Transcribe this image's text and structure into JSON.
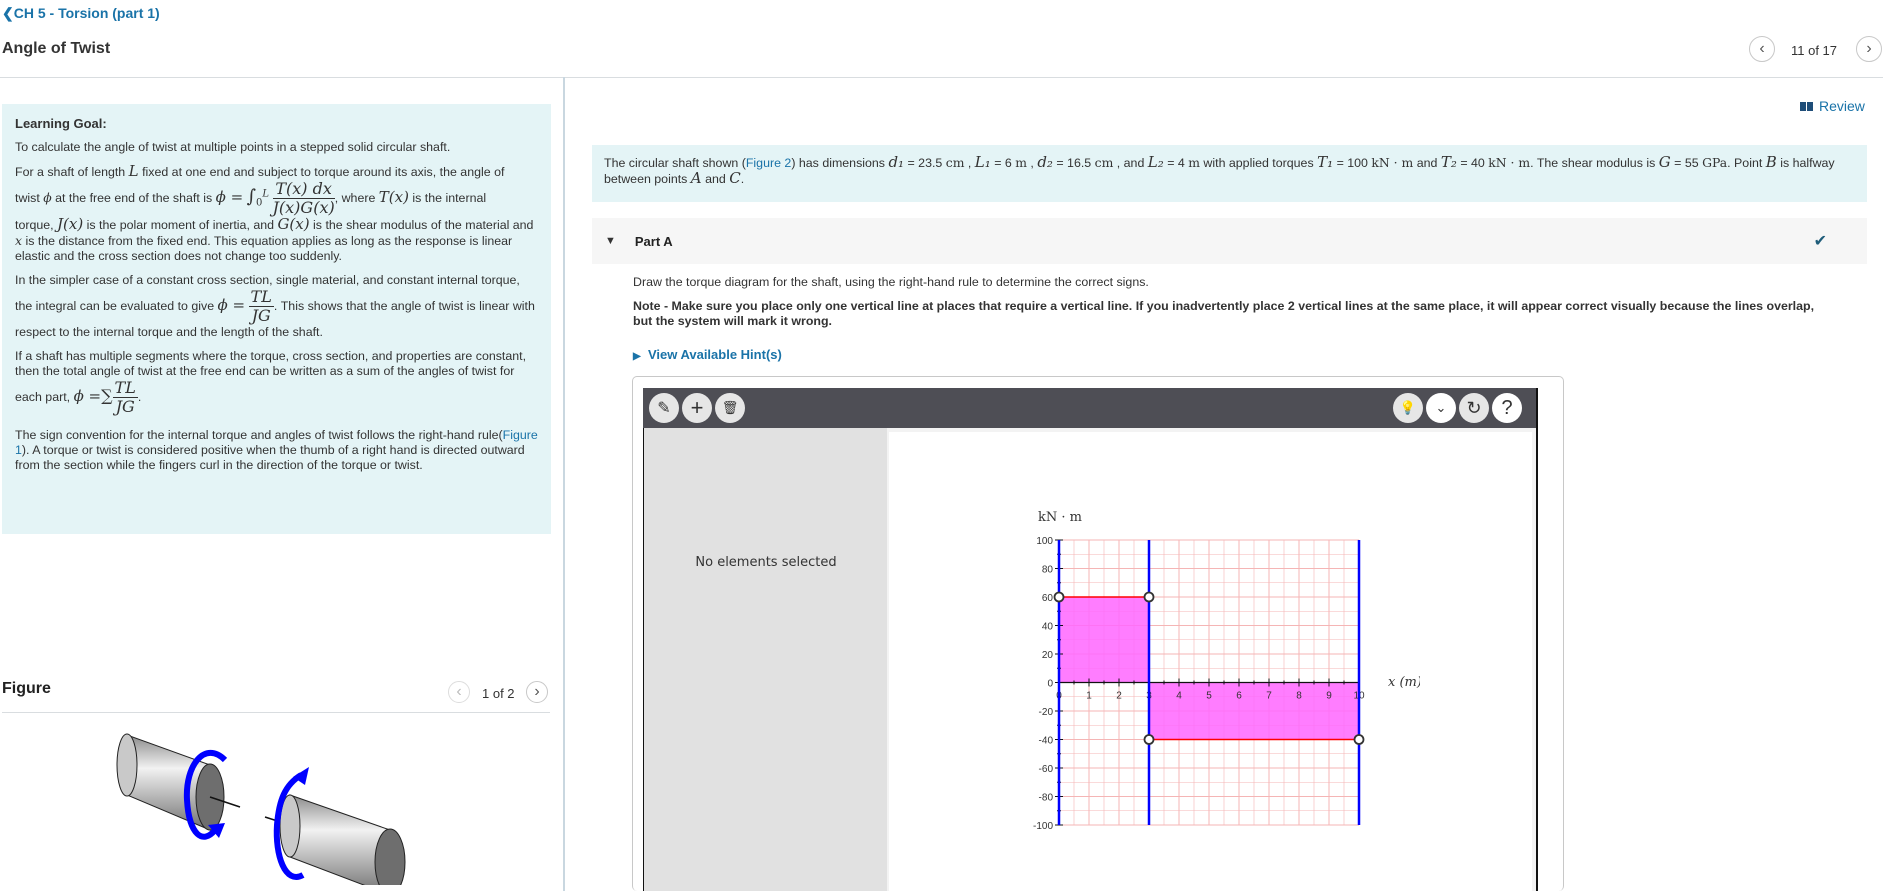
{
  "header": {
    "breadcrumb": "CH 5 - Torsion (part 1)",
    "title": "Angle of Twist",
    "pager": "11 of 17",
    "review_label": "Review"
  },
  "learning_goal": {
    "title": "Learning Goal:",
    "p1": "To calculate the angle of twist at multiple points in a stepped solid circular shaft.",
    "p2a": "For a shaft of length ",
    "p2b": " fixed at one end and subject to torque around its axis, the angle of",
    "p2c": "twist ",
    "p2d": " at the free end of the shaft is ",
    "p2e": ", where ",
    "p2f": " is the internal",
    "p2g": "torque, ",
    "p2h": " is the polar moment of inertia, and ",
    "p2i": " is the shear modulus of the material and ",
    "p2j": " is the distance from the fixed end. This equation applies as long as the response is linear elastic and the cross section does not change too suddenly.",
    "p3a": "In the simpler case of a constant cross section, single material, and constant internal torque, the integral can be evaluated to give ",
    "p3b": ". This shows that the angle of twist is linear with respect to the internal torque and the length of the shaft.",
    "p4a": "If a shaft has multiple segments where the torque, cross section, and properties are constant, then the total angle of twist at the free end can be written as a sum of the angles of twist for each part, ",
    "p5a": "The sign convention for the internal torque and angles of twist follows the right-hand rule(",
    "p5link": "Figure 1",
    "p5b": "). A torque or twist is considered positive when the thumb of a right hand is directed outward from the section while the fingers curl in the direction of the torque or twist.",
    "math": {
      "L": "L",
      "phi": "ϕ",
      "phi_eq": "ϕ =",
      "integral": "∫",
      "int_upper": "L",
      "int_lower": "0",
      "int_num": "T(x) dx",
      "int_den": "J(x)G(x)",
      "Tx": "T(x)",
      "Jx": "J(x)",
      "Gx": "G(x)",
      "x": "x",
      "tl": "TL",
      "jg": "JG",
      "sum": "∑"
    }
  },
  "figure": {
    "title": "Figure",
    "pager": "1 of 2",
    "colors": {
      "arrow": "#0000ff",
      "cylinder_end": "#6e6e6e"
    }
  },
  "problem": {
    "t1": "The circular shaft shown (",
    "link": "Figure 2",
    "t2": ") has dimensions ",
    "d1": "d₁",
    "d1v": " = 23.5 ",
    "cm": "cm",
    "L1": "L₁",
    "L1v": " = 6 ",
    "m": "m",
    "d2": "d₂",
    "d2v": " = 16.5 ",
    "L2": "L₂",
    "L2v": " = 4 ",
    "t3": " with applied torques ",
    "T1": "T₁",
    "T1v": " = 100 ",
    "knm": "kN · m",
    "t4": " and ",
    "T2": "T₂",
    "T2v": " = 40 ",
    "t5": ". The shear modulus is ",
    "G": "G",
    "Gv": " = 55 ",
    "gpa": "GPa",
    "t6": ". Point ",
    "B": "B",
    "t7": " is halfway between points ",
    "A": "A",
    "and": " and ",
    "C": "C",
    "dot": ".",
    "comma": " , ",
    "and2": " , and "
  },
  "part_a": {
    "title": "Part A",
    "instruction": "Draw the torque diagram for the shaft, using the right-hand rule to determine the correct signs.",
    "note": "Note - Make sure you place only one vertical line at places that require a vertical line. If you inadvertently place 2 vertical lines at the same place, it will appear correct visually because the lines overlap, but the system will mark it wrong.",
    "hint_label": "View Available Hint(s)",
    "status": "correct"
  },
  "tool": {
    "toolbar_left": [
      {
        "name": "draw-segment-icon",
        "glyph": "✎"
      },
      {
        "name": "add-icon",
        "glyph": "+"
      },
      {
        "name": "trash-icon",
        "glyph": "🗑"
      }
    ],
    "toolbar_right": [
      {
        "name": "lightbulb-icon",
        "glyph": "💡"
      },
      {
        "name": "chevron-down-icon",
        "glyph": "⌄"
      },
      {
        "name": "reset-icon",
        "glyph": "↻"
      },
      {
        "name": "help-icon",
        "glyph": "?"
      }
    ],
    "side_text": "No elements selected"
  },
  "chart_data": {
    "type": "area",
    "title": "",
    "ylabel": "kN · m",
    "xlabel": "x (m)",
    "xlim": [
      0,
      10
    ],
    "ylim": [
      -100,
      100
    ],
    "x_ticks": [
      0,
      1,
      2,
      3,
      4,
      5,
      6,
      7,
      8,
      9,
      10
    ],
    "y_ticks": [
      100,
      80,
      60,
      40,
      20,
      0,
      -20,
      -40,
      -60,
      -80,
      -100
    ],
    "grid": true,
    "segments": [
      {
        "x": [
          0,
          3
        ],
        "value": 60
      },
      {
        "x": [
          3,
          10
        ],
        "value": -40
      }
    ],
    "vertical_lines": [
      0,
      3,
      10
    ],
    "points": [
      {
        "x": 0,
        "y": 60
      },
      {
        "x": 3,
        "y": 60
      },
      {
        "x": 3,
        "y": -40
      },
      {
        "x": 10,
        "y": -40
      }
    ],
    "colors": {
      "fill": "#ff66ff",
      "vline": "#0000ff",
      "hline": "#ff0000",
      "grid": "#f5b5b5"
    }
  }
}
